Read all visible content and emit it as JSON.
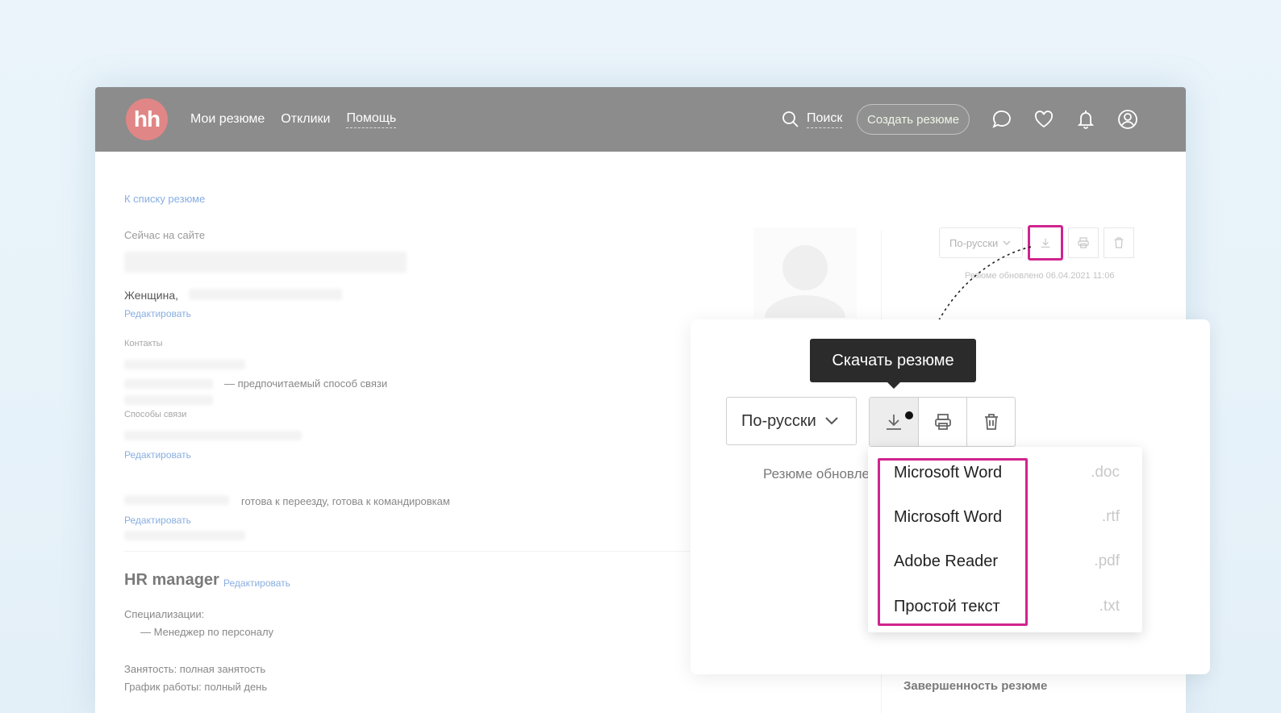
{
  "nav": {
    "logo": "hh",
    "items": [
      "Мои резюме",
      "Отклики",
      "Помощь"
    ],
    "search": "Поиск",
    "create": "Создать резюме"
  },
  "page": {
    "back_link": "К списку резюме",
    "online": "Сейчас на сайте",
    "gender": "Женщина,",
    "edit": "Редактировать",
    "contacts": "Контакты",
    "preferred": "— предпочитаемый способ связи",
    "ways": "Способы связи",
    "relocation": "готова к переезду, готова к командировкам",
    "position": "HR manager",
    "spec_label": "Специализации:",
    "spec_item": "— Менеджер по персоналу",
    "employment": "Занятость: полная занятость",
    "schedule": "График работы: полный день",
    "lang_small": "По-русски",
    "updated_small": "Резюме обновлено 06.04.2021 11:06",
    "completeness": "Завершенность резюме"
  },
  "panel": {
    "tooltip": "Скачать резюме",
    "lang": "По-русски",
    "updated": "Резюме обновлено",
    "menu": [
      {
        "name": "Microsoft Word",
        "ext": ".doc"
      },
      {
        "name": "Microsoft Word",
        "ext": ".rtf"
      },
      {
        "name": "Adobe Reader",
        "ext": ".pdf"
      },
      {
        "name": "Простой текст",
        "ext": ".txt"
      }
    ]
  },
  "colors": {
    "topbar": "#8c8c8c",
    "logo": "#e08686",
    "highlight": "#d0248e",
    "link": "#88aee0"
  }
}
